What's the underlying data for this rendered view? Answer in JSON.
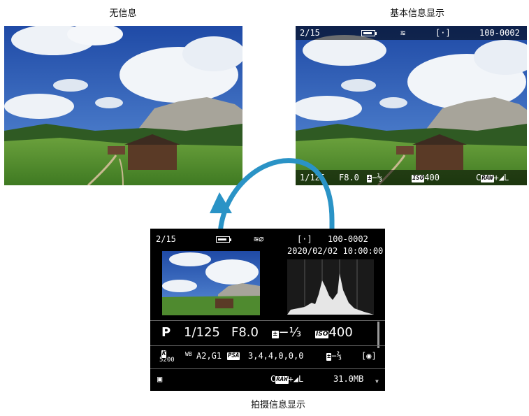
{
  "captions": {
    "no_info": "无信息",
    "basic_info": "基本信息显示",
    "shooting_info": "拍摄信息显示"
  },
  "basic": {
    "frame": "2/15",
    "battery_icon": "battery-icon",
    "wifi_icon": "wifi-icon",
    "af_icon": "af-frame-icon",
    "file": "100-0002",
    "shutter": "1/125",
    "aperture": "F8.0",
    "exp_comp": "−⅓",
    "iso_label": "ISO",
    "iso": "400",
    "quality_raw": "RAW",
    "quality_c": "C",
    "quality_jpeg": "+◢L"
  },
  "shooting": {
    "frame": "2/15",
    "file": "100-0002",
    "datetime": "2020/02/02 10:00:00",
    "mode": "P",
    "shutter": "1/125",
    "aperture": "F8.0",
    "exp_comp": "−⅓",
    "iso_label": "ISO",
    "iso": "400",
    "wb_badge": "K",
    "wb_kelvin": "5200",
    "wb_label": "WB",
    "wb_shift": "A2,G1",
    "picture_style_badge": "PSA",
    "picture_style": "3,4,4,0,0,0",
    "flash_comp": "−⅔",
    "quality_c": "C",
    "quality_raw": "RAW",
    "quality_jpeg": "+◢L",
    "file_size": "31.0MB"
  },
  "colors": {
    "arrow": "#2a93c6",
    "sky": "#2f5fb8",
    "grass": "#4f8a2f"
  }
}
